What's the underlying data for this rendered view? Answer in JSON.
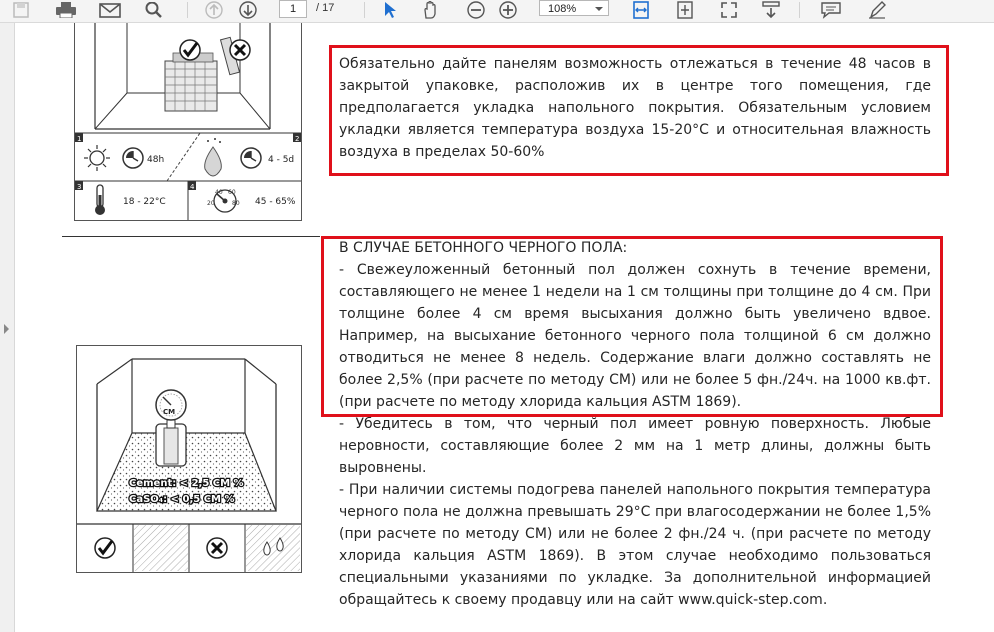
{
  "toolbar": {
    "page_current": "1",
    "page_total": "/ 17",
    "zoom": "108%",
    "icons": [
      "save-icon",
      "print-icon",
      "email-icon",
      "search-icon",
      "prev-page-icon",
      "next-page-icon",
      "select-cursor-icon",
      "hand-icon",
      "zoom-out-icon",
      "zoom-in-icon",
      "fit-width-icon",
      "fit-page-icon",
      "fullscreen-icon",
      "scroll-icon",
      "comment-icon",
      "sign-icon"
    ]
  },
  "figure1": {
    "panel1_num": "1",
    "panel2_num": "2",
    "panel3_num": "3",
    "panel4_num": "4",
    "clock1_label": "48h",
    "clock2_label": "4 - 5d",
    "temp_label": "18 - 22°C",
    "humidity_label": "45 - 65%",
    "humidity_scale": [
      "40",
      "60",
      "80",
      "20"
    ]
  },
  "figure2": {
    "gauge_label": "CM",
    "cement_line": "Cement: < 2,5 CM %",
    "caso4_line": "CaSO₄: < 0,5 CM %"
  },
  "section1": {
    "text": "Обязательно дайте панелям возможность отлежаться в течение 48 часов в закрытой упаковке, расположив их в центре того помещения, где предполагается укладка напольного покрытия. Обязательным условием укладки является температура воздуха 15-20°C и относительная влажность воздуха в пределах 50-60%"
  },
  "section2": {
    "heading": "В СЛУЧАЕ БЕТОННОГО ЧЕРНОГО ПОЛА:",
    "para1": "- Свежеуложенный бетонный пол должен сохнуть в течение времени, составляющего не менее 1 недели на 1 см толщины при толщине до 4 см. При толщине более 4 см время высыхания должно быть увеличено вдвое. Например, на высыхание бетонного черного пола толщиной 6 см должно отводиться не менее 8 недель. Содержание влаги должно составлять не более 2,5% (при расчете по методу CM) или не более 5 фн./24ч. на 1000 кв.фт. (при расчете по методу хлорида кальция ASTM 1869).",
    "para2": "- Убедитесь в том, что черный пол имеет ровную поверхность. Любые неровности, составляющие более 2 мм на 1 метр длины, должны быть выровнены.",
    "para3": "- При наличии системы подогрева панелей напольного покрытия температура черного пола не должна превышать 29°C при влагосодержании не более 1,5% (при расчете по методу CM) или не более 2 фн./24 ч. (при расчете по методу хлорида кальция ASTM 1869). В этом случае необходимо пользоваться специальными указаниями по укладке. За дополнительной информацией обращайтесь к своему продавцу или на сайт www.quick-step.com."
  },
  "colors": {
    "highlight": "#e0101a",
    "toolbar_bg": "#f4f4f4",
    "accent_icon": "#1f6fd0"
  }
}
